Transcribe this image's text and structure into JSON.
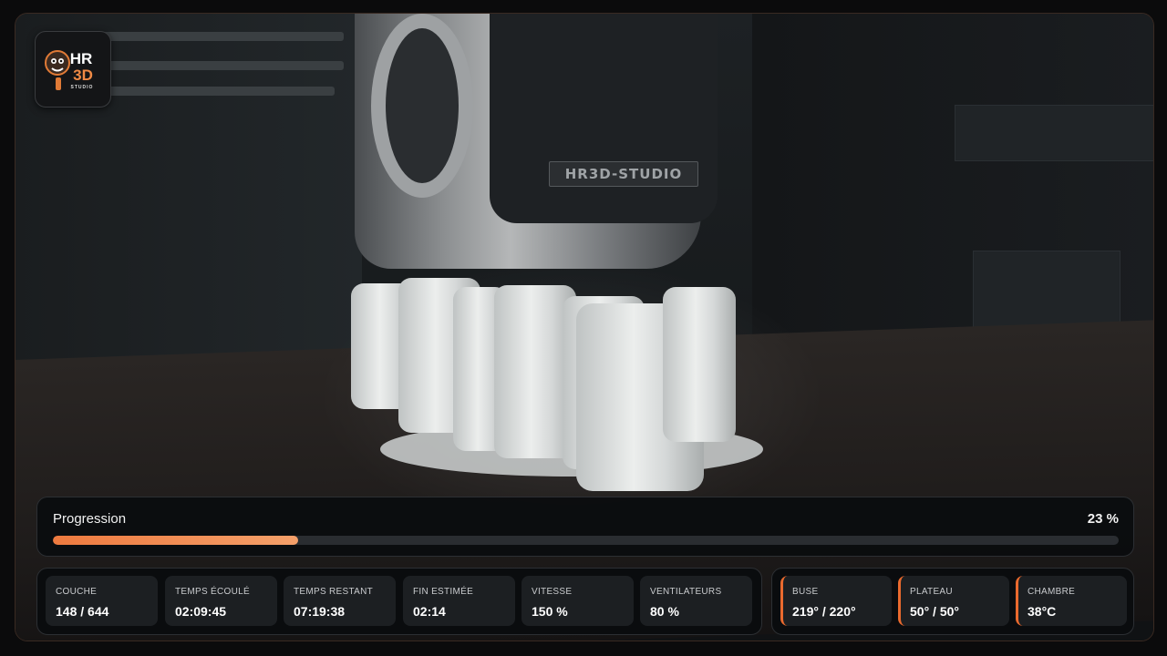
{
  "progress": {
    "label": "Progression",
    "value_text": "23 %",
    "percent": 23
  },
  "stats": [
    {
      "label": "COUCHE",
      "value": "148 / 644"
    },
    {
      "label": "TEMPS ÉCOULÉ",
      "value": "02:09:45"
    },
    {
      "label": "TEMPS RESTANT",
      "value": "07:19:38"
    },
    {
      "label": "FIN ESTIMÉE",
      "value": "02:14"
    },
    {
      "label": "VITESSE",
      "value": "150 %"
    },
    {
      "label": "VENTILATEURS",
      "value": "80 %"
    }
  ],
  "temperatures": [
    {
      "label": "BUSE",
      "value": "219° / 220°"
    },
    {
      "label": "PLATEAU",
      "value": "50° / 50°"
    },
    {
      "label": "CHAMBRE",
      "value": "38°C"
    }
  ],
  "camera": {
    "nameplate": "HR3D-STUDIO"
  },
  "logo": {
    "line1": "HR",
    "line2": "3D",
    "line3": "STUDIO"
  },
  "colors": {
    "accent": "#ea6a2e",
    "progress_fill": "#f09156",
    "panel_bg": "#0a0c0e",
    "tile_bg": "#1c1f22"
  }
}
